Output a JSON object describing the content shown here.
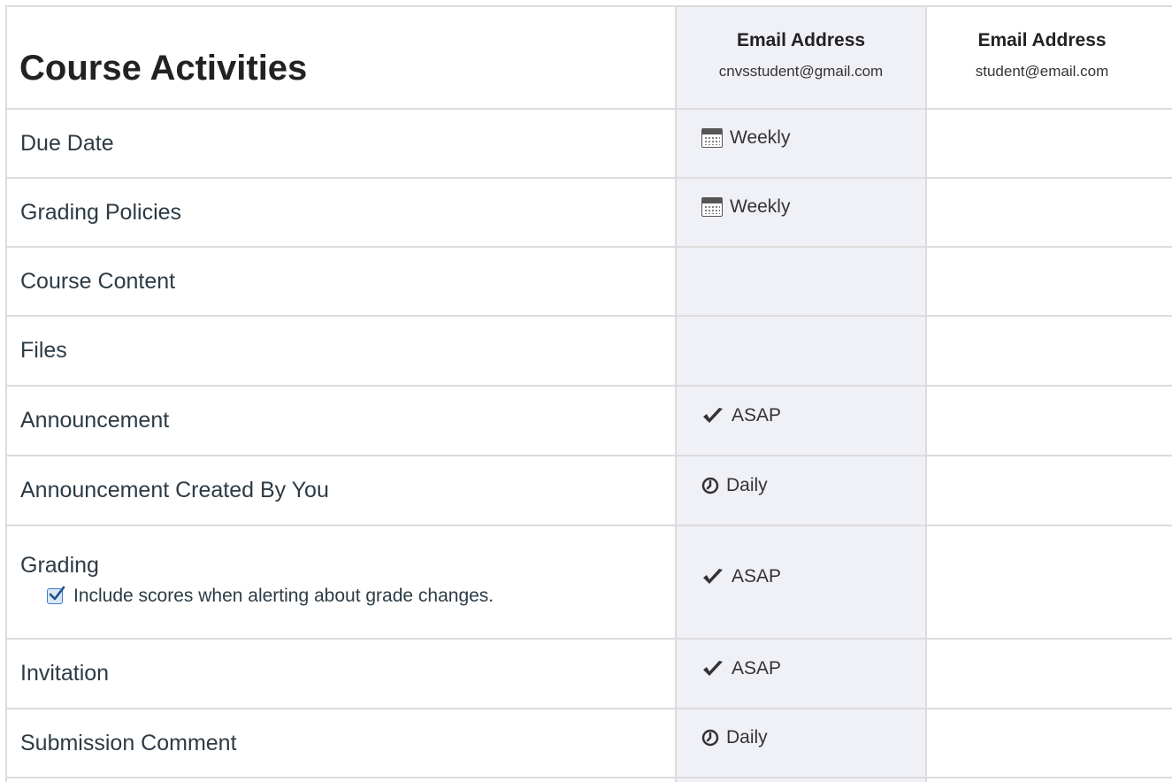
{
  "table": {
    "heading": "Course Activities",
    "columns": [
      {
        "title": "Email Address",
        "email": "cnvsstudent@gmail.com"
      },
      {
        "title": "Email Address",
        "email": "student@email.com"
      }
    ],
    "rows": [
      {
        "label": "Due Date",
        "frequency": "Weekly",
        "icon": "calendar-icon"
      },
      {
        "label": "Grading Policies",
        "frequency": "Weekly",
        "icon": "calendar-icon"
      },
      {
        "label": "Course Content",
        "frequency": "",
        "icon": ""
      },
      {
        "label": "Files",
        "frequency": "",
        "icon": ""
      },
      {
        "label": "Announcement",
        "frequency": "ASAP",
        "icon": "check-icon"
      },
      {
        "label": "Announcement Created By You",
        "frequency": "Daily",
        "icon": "clock-icon"
      },
      {
        "label": "Grading",
        "frequency": "ASAP",
        "icon": "check-icon",
        "option": {
          "label": "Include scores when alerting about grade changes.",
          "checked": true
        }
      },
      {
        "label": "Invitation",
        "frequency": "ASAP",
        "icon": "check-icon"
      },
      {
        "label": "Submission Comment",
        "frequency": "Daily",
        "icon": "clock-icon"
      }
    ]
  },
  "colors": {
    "selected_column_bg": "#f0f1f7",
    "border": "#dcdcdc",
    "checkbox_accent": "#3e7bc4"
  }
}
